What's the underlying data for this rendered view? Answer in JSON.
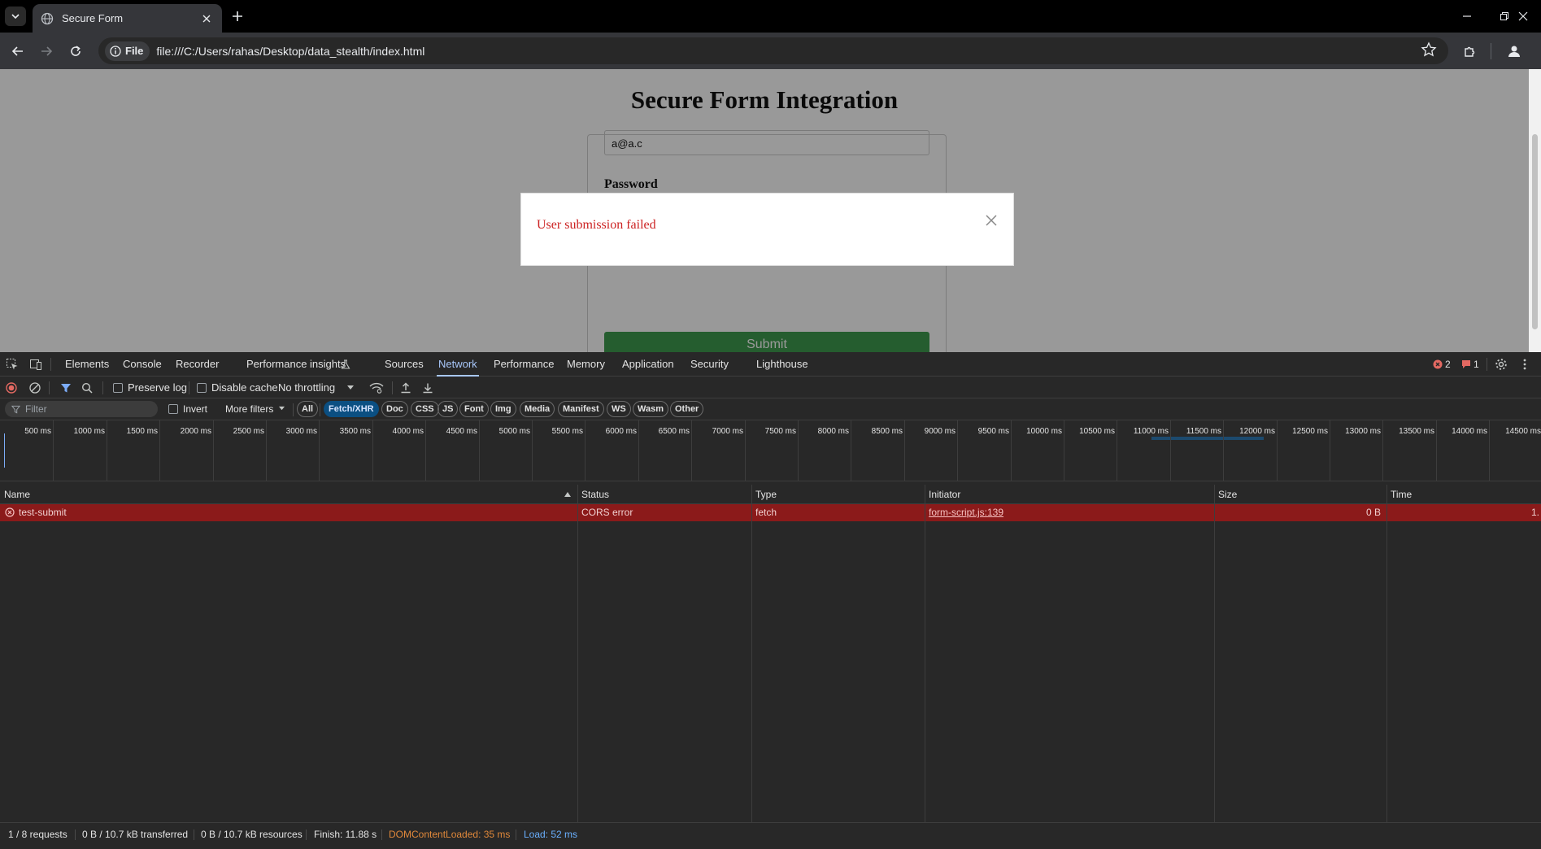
{
  "browser": {
    "tab_title": "Secure Form",
    "site_chip": "File",
    "url": "file:///C:/Users/rahas/Desktop/data_stealth/index.html"
  },
  "page": {
    "title": "Secure Form Integration",
    "email_value": "a@a.c",
    "password_label": "Password",
    "submit_label": "Submit",
    "modal_message": "User submission failed"
  },
  "devtools": {
    "tabs": [
      "Elements",
      "Console",
      "Recorder",
      "Performance insights",
      "Sources",
      "Network",
      "Performance",
      "Memory",
      "Application",
      "Security",
      "Lighthouse"
    ],
    "active_tab": "Network",
    "error_count": "2",
    "issue_count": "1",
    "controls": {
      "preserve_log": "Preserve log",
      "disable_cache": "Disable cache",
      "throttling": "No throttling"
    },
    "filter": {
      "placeholder": "Filter",
      "invert": "Invert",
      "more_filters": "More filters",
      "types": [
        "All",
        "Fetch/XHR",
        "Doc",
        "CSS",
        "JS",
        "Font",
        "Img",
        "Media",
        "Manifest",
        "WS",
        "Wasm",
        "Other"
      ],
      "active_type": "Fetch/XHR"
    },
    "timeline_ticks": [
      "500 ms",
      "1000 ms",
      "1500 ms",
      "2000 ms",
      "2500 ms",
      "3000 ms",
      "3500 ms",
      "4000 ms",
      "4500 ms",
      "5000 ms",
      "5500 ms",
      "6000 ms",
      "6500 ms",
      "7000 ms",
      "7500 ms",
      "8000 ms",
      "8500 ms",
      "9000 ms",
      "9500 ms",
      "10000 ms",
      "10500 ms",
      "11000 ms",
      "11500 ms",
      "12000 ms",
      "12500 ms",
      "13000 ms",
      "13500 ms",
      "14000 ms",
      "14500 ms"
    ],
    "columns": [
      "Name",
      "Status",
      "Type",
      "Initiator",
      "Size",
      "Time"
    ],
    "requests": [
      {
        "name": "test-submit",
        "status": "CORS error",
        "type": "fetch",
        "initiator": "form-script.js:139",
        "size": "0 B",
        "time": "1."
      }
    ],
    "status": {
      "requests": "1 / 8 requests",
      "transferred": "0 B / 10.7 kB transferred",
      "resources": "0 B / 10.7 kB resources",
      "finish": "Finish: 11.88 s",
      "dom_loaded": "DOMContentLoaded: 35 ms",
      "load": "Load: 52 ms"
    },
    "colors": {
      "dom_loaded": "#e0883a",
      "load": "#6ab0ff",
      "error_row": "#8b1a1a",
      "accent": "#a8c7fa"
    }
  }
}
